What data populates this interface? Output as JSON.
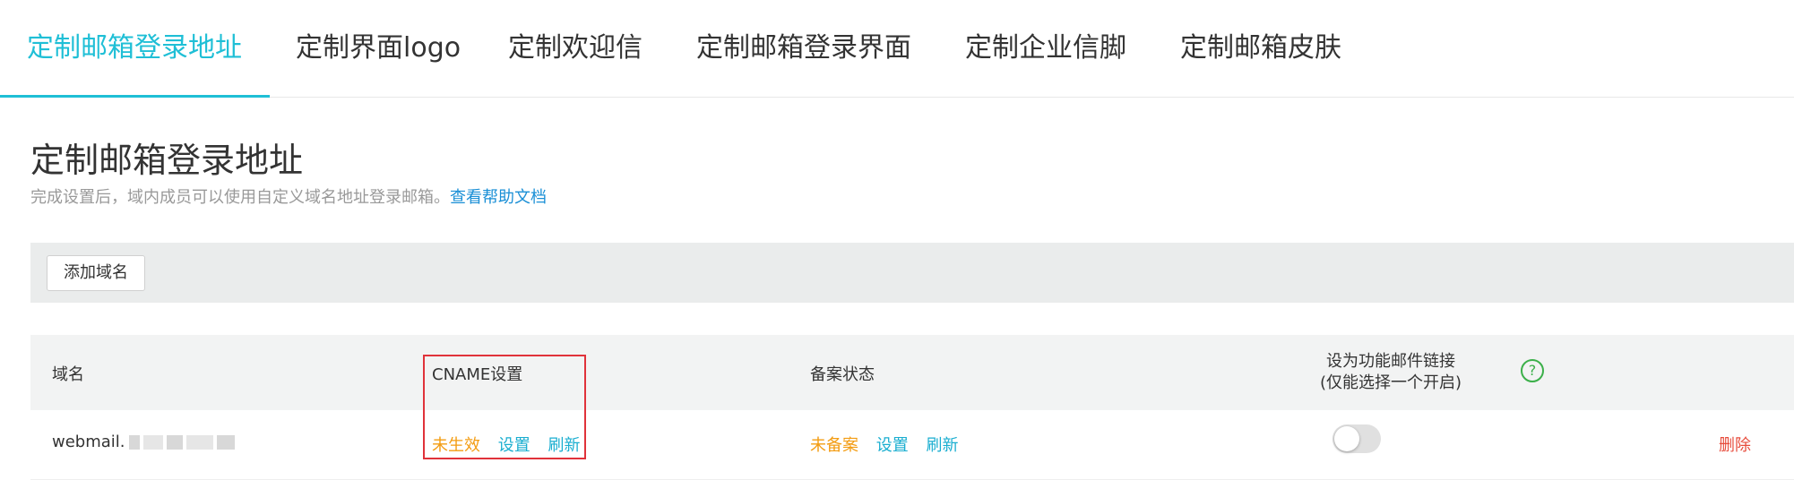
{
  "tabs": [
    {
      "label": "定制邮箱登录地址"
    },
    {
      "label": "定制界面logo"
    },
    {
      "label": "定制欢迎信"
    },
    {
      "label": "定制邮箱登录界面"
    },
    {
      "label": "定制企业信脚"
    },
    {
      "label": "定制邮箱皮肤"
    }
  ],
  "page": {
    "title": "定制邮箱登录地址",
    "description": "完成设置后，域内成员可以使用自定义域名地址登录邮箱。",
    "help_link": "查看帮助文档"
  },
  "toolbar": {
    "add_domain_label": "添加域名"
  },
  "table": {
    "headers": {
      "domain": "域名",
      "cname": "CNAME设置",
      "filing": "备案状态",
      "feature_line1": "设为功能邮件链接",
      "feature_line2": "(仅能选择一个开启)"
    },
    "help_icon": "?",
    "rows": [
      {
        "domain": "webmail.",
        "cname_status": "未生效",
        "cname_set": "设置",
        "cname_refresh": "刷新",
        "filing_status": "未备案",
        "filing_set": "设置",
        "filing_refresh": "刷新",
        "feature_enabled": false,
        "delete": "删除"
      }
    ]
  },
  "colors": {
    "accent": "#1fbfd6",
    "warning": "#f39c12",
    "danger": "#e74c3c",
    "help_green": "#3cb04a",
    "highlight_box": "#e0323a"
  },
  "icons": {
    "help": "help-circle-icon"
  }
}
